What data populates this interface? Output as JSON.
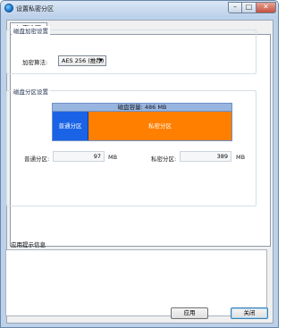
{
  "window": {
    "title": "设置私密分区"
  },
  "titlebar_buttons": {
    "minimize": "–",
    "maximize": "□",
    "close": "✕"
  },
  "tabs": [
    {
      "label": "加密选项"
    }
  ],
  "encryption": {
    "group_title": "磁盘加密设置",
    "algorithm_label": "加密算法:",
    "algorithm_value": "AES 256 (推荐)"
  },
  "partition": {
    "group_title": "磁盘分区设置",
    "capacity_text": "磁盘容量: 486 MB",
    "normal_segment_label": "普通分区",
    "private_segment_label": "私密分区",
    "normal_label": "普通分区:",
    "normal_value": "97",
    "normal_unit": "MB",
    "private_label": "私密分区:",
    "private_value": "389",
    "private_unit": "MB",
    "normal_fraction": 0.2,
    "colors": {
      "normal": "#1a63e6",
      "private": "#ff7f00",
      "header": "#98b5e0"
    }
  },
  "hint": {
    "label": "应用提示信息"
  },
  "buttons": {
    "apply": "应用",
    "close": "关闭"
  }
}
